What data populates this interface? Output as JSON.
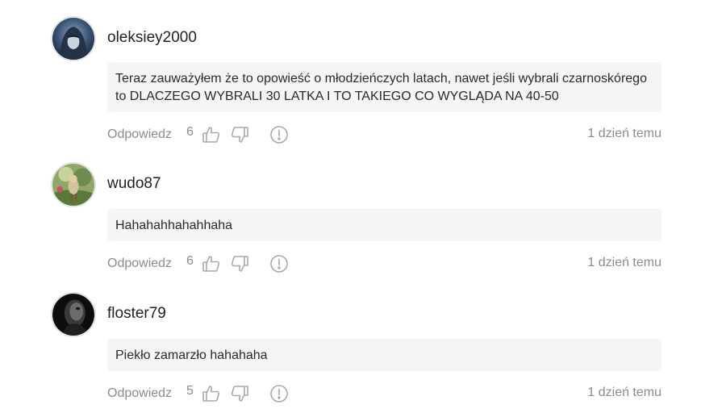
{
  "comments": [
    {
      "username": "oleksiey2000",
      "text_lines": [
        "Teraz zauważyłem że to opowieść o młodzieńczych latach, nawet jeśli wybrali czarnoskórego",
        "to DLACZEGO WYBRALI 30 LATKA I TO TAKIEGO CO WYGLĄDA NA 40-50"
      ],
      "reply_label": "Odpowiedz",
      "likes": "6",
      "time": "1 dzień temu",
      "avatar_icon": "avatar-hooded-figure"
    },
    {
      "username": "wudo87",
      "text_lines": [
        "Hahahahhahahhaha"
      ],
      "reply_label": "Odpowiedz",
      "likes": "6",
      "time": "1 dzień temu",
      "avatar_icon": "avatar-fantasy-scene"
    },
    {
      "username": "floster79",
      "text_lines": [
        "Piekło zamarzło hahahaha"
      ],
      "reply_label": "Odpowiedz",
      "likes": "5",
      "time": "1 dzień temu",
      "avatar_icon": "avatar-dark-face"
    }
  ],
  "colors": {
    "bubble_bg": "#f5f5f5",
    "muted_text": "#8c8c8c",
    "icon_stroke": "#a9a9a9"
  }
}
